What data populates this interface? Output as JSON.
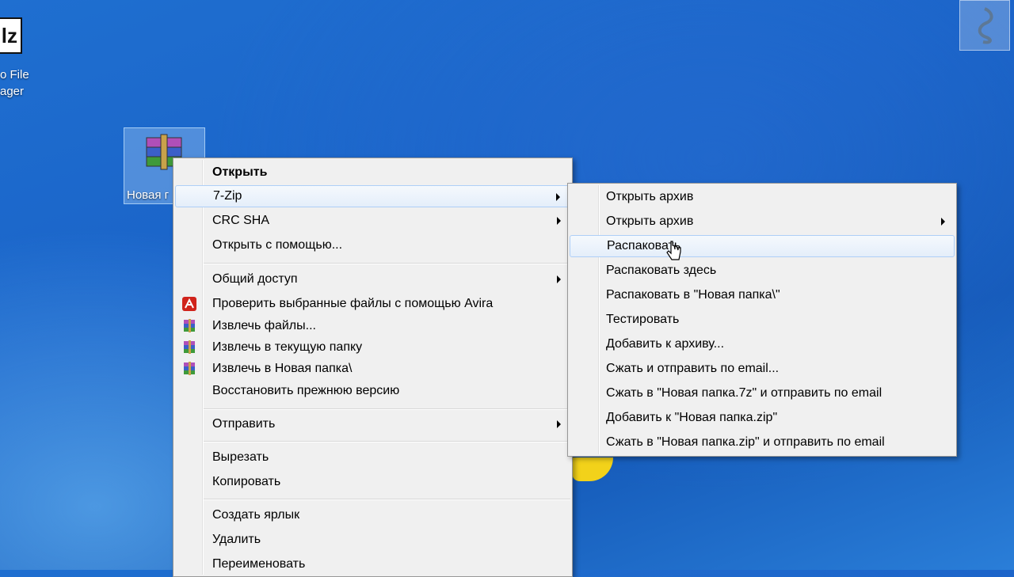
{
  "desktop": {
    "left_icon": {
      "glyph": "lz",
      "label_line1": "o File",
      "label_line2": "ager"
    },
    "selected_icon": {
      "label": "Новая г",
      "icon": "winrar-archive-icon"
    },
    "watermark_icon": "dragon-icon"
  },
  "context_menu": {
    "items": [
      {
        "label": "Открыть"
      },
      {
        "label": "7-Zip"
      },
      {
        "label": "CRC SHA"
      },
      {
        "label": "Открыть с помощью..."
      },
      {
        "label": "Общий доступ"
      },
      {
        "label": "Проверить выбранные файлы с помощью Avira",
        "icon": "avira-icon"
      },
      {
        "label": "Извлечь файлы...",
        "icon": "winrar-icon"
      },
      {
        "label": "Извлечь в текущую папку",
        "icon": "winrar-icon"
      },
      {
        "label": "Извлечь в Новая папка\\",
        "icon": "winrar-icon"
      },
      {
        "label": "Восстановить прежнюю версию"
      },
      {
        "label": "Отправить"
      },
      {
        "label": "Вырезать"
      },
      {
        "label": "Копировать"
      },
      {
        "label": "Создать ярлык"
      },
      {
        "label": "Удалить"
      },
      {
        "label": "Переименовать"
      }
    ]
  },
  "submenu_7zip": {
    "items": [
      {
        "label": "Открыть архив"
      },
      {
        "label": "Открыть архив"
      },
      {
        "label": "Распаковать"
      },
      {
        "label": "Распаковать здесь"
      },
      {
        "label": "Распаковать в \"Новая папка\\\""
      },
      {
        "label": "Тестировать"
      },
      {
        "label": "Добавить к архиву..."
      },
      {
        "label": "Сжать и отправить по email..."
      },
      {
        "label": "Сжать в \"Новая папка.7z\" и отправить по email"
      },
      {
        "label": "Добавить к \"Новая папка.zip\""
      },
      {
        "label": "Сжать в \"Новая папка.zip\" и отправить по email"
      }
    ]
  },
  "colors": {
    "desktop": "#1a63c8",
    "menu_bg": "#f0f0f0",
    "hover_border": "#aecff7",
    "avira": "#d0231b"
  }
}
